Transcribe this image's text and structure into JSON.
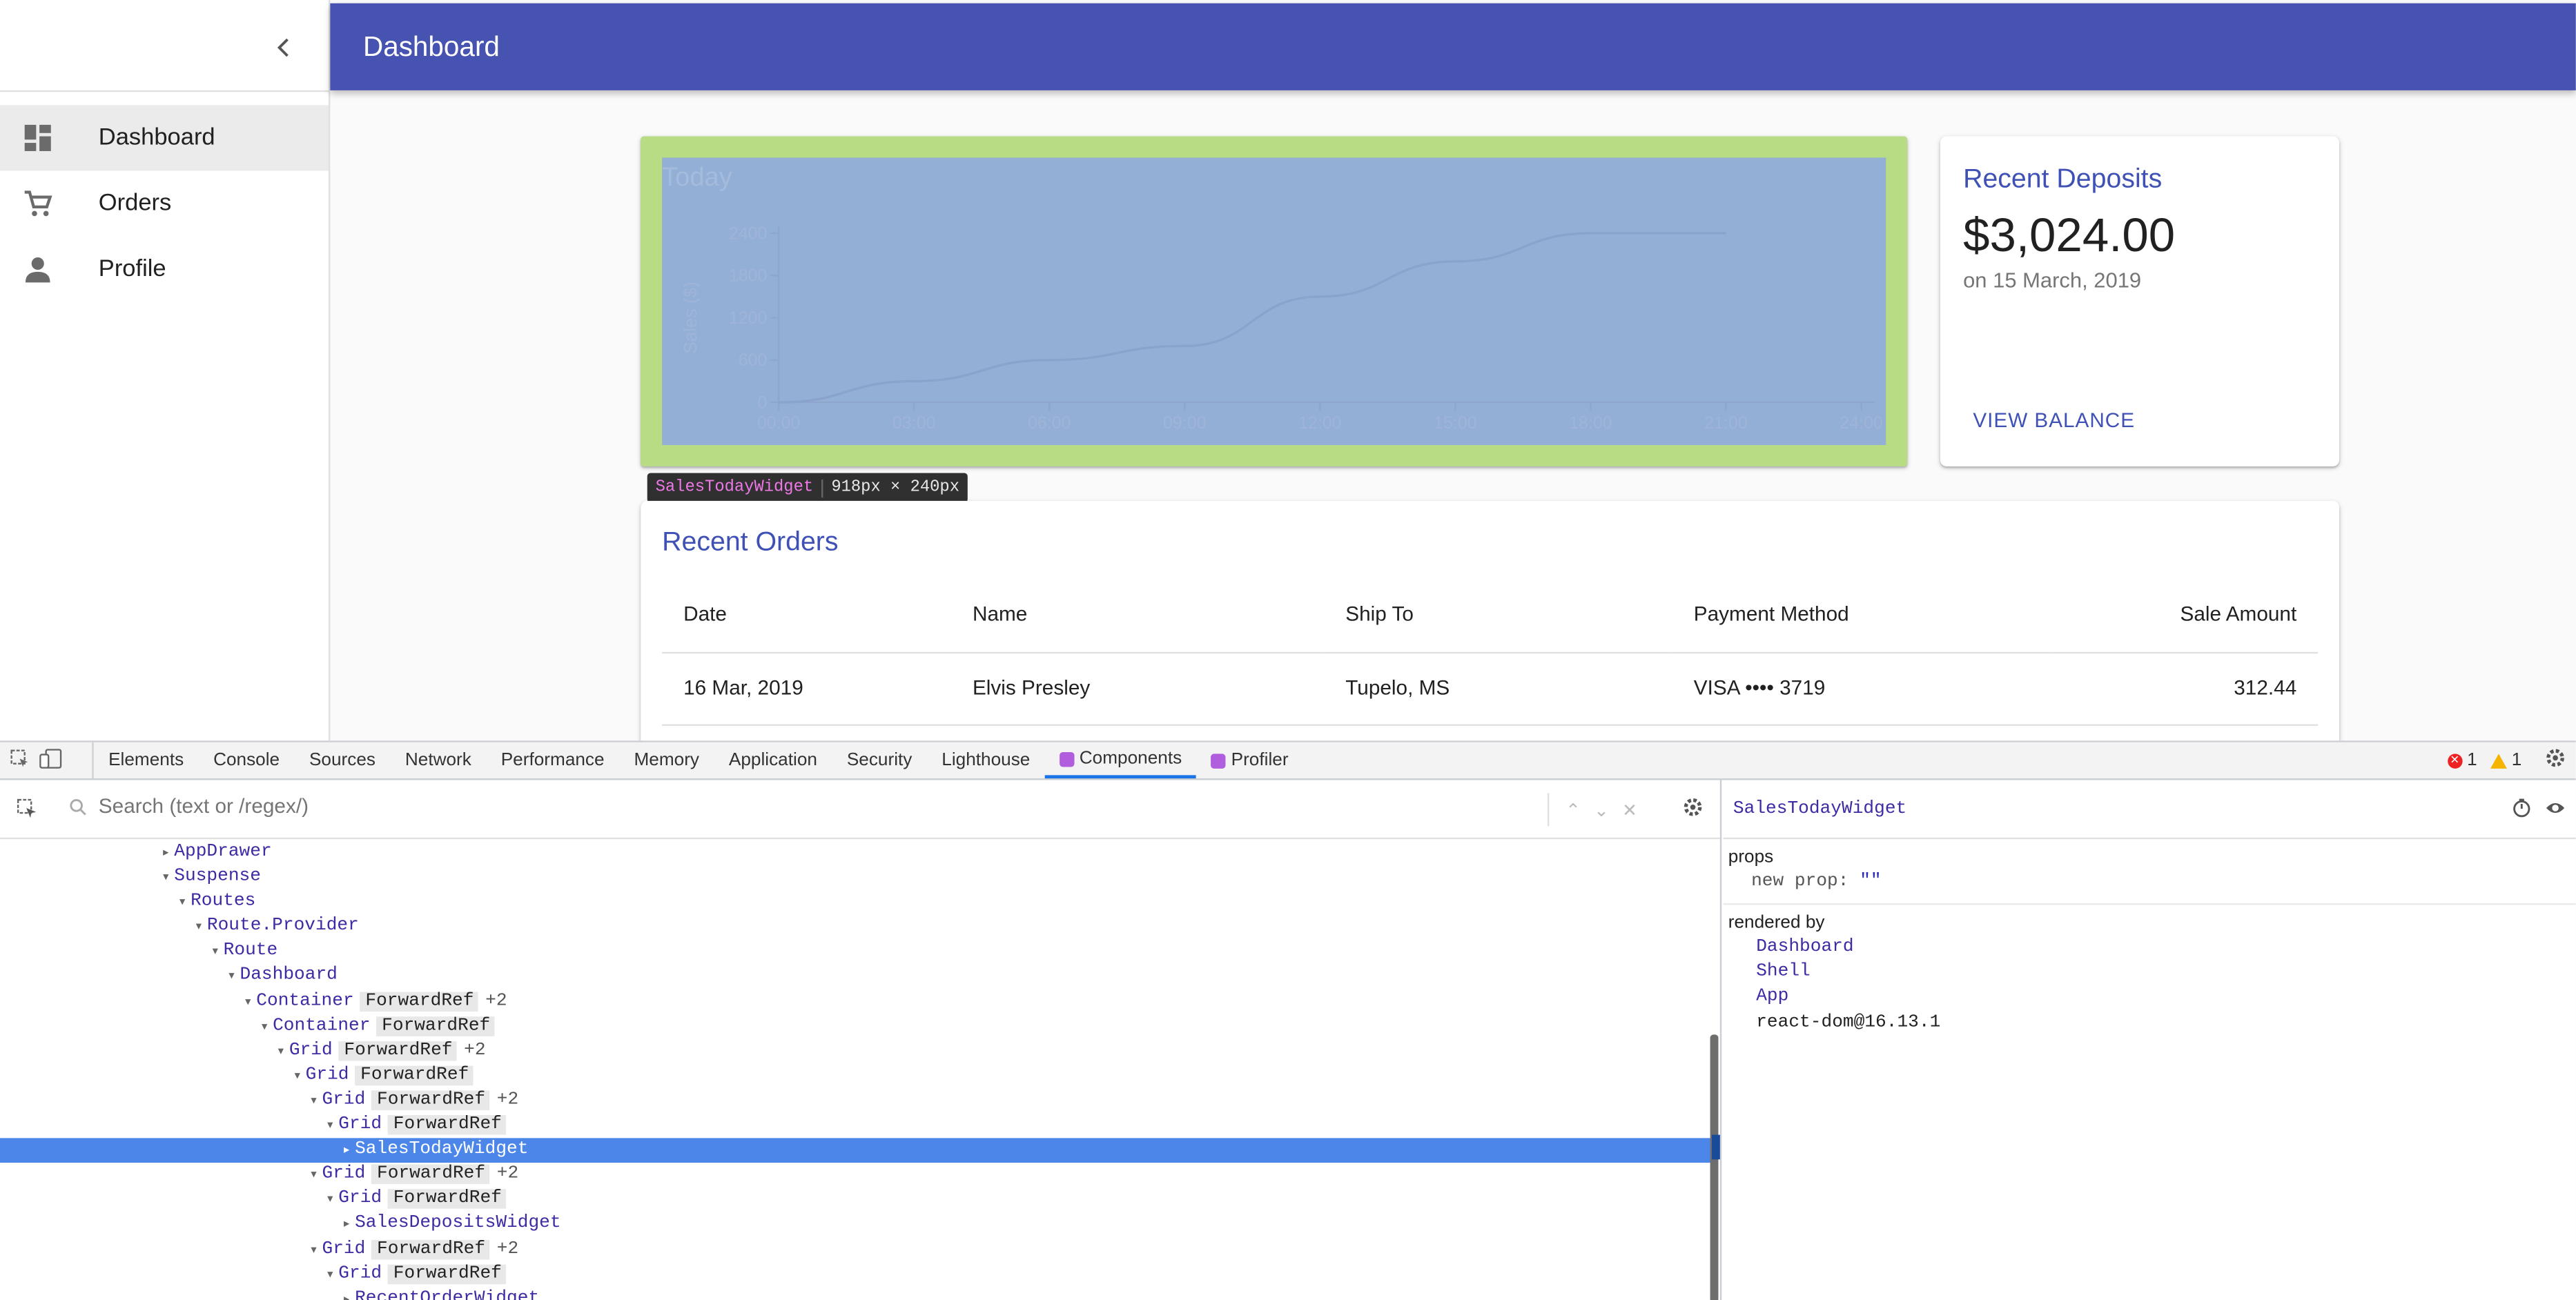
{
  "app": {
    "title": "Dashboard",
    "nav": [
      {
        "label": "Dashboard",
        "icon": "dashboard-icon",
        "active": true
      },
      {
        "label": "Orders",
        "icon": "cart-icon",
        "active": false
      },
      {
        "label": "Profile",
        "icon": "person-icon",
        "active": false
      }
    ],
    "today": {
      "title": "Today",
      "y_label": "Sales ($)",
      "x_ticks": [
        "00:00",
        "03:00",
        "06:00",
        "09:00",
        "12:00",
        "15:00",
        "18:00",
        "21:00",
        "24:00"
      ],
      "y_ticks": [
        "0",
        "600",
        "1200",
        "1800",
        "2400"
      ]
    },
    "inspect_tooltip": {
      "name": "SalesTodayWidget",
      "size": "918px × 240px"
    },
    "deposits": {
      "title": "Recent Deposits",
      "amount": "$3,024.00",
      "date": "on 15 March, 2019",
      "link": "VIEW BALANCE"
    },
    "orders": {
      "title": "Recent Orders",
      "columns": [
        "Date",
        "Name",
        "Ship To",
        "Payment Method",
        "Sale Amount"
      ],
      "rows": [
        {
          "date": "16 Mar, 2019",
          "name": "Elvis Presley",
          "ship_to": "Tupelo, MS",
          "payment": "VISA  •••• 3719",
          "amount": "312.44"
        }
      ]
    }
  },
  "chart_data": {
    "type": "line",
    "title": "Today",
    "ylabel": "Sales ($)",
    "xlabel": "",
    "x": [
      "00:00",
      "03:00",
      "06:00",
      "09:00",
      "12:00",
      "15:00",
      "18:00",
      "21:00"
    ],
    "values": [
      0,
      300,
      600,
      800,
      1500,
      2000,
      2400,
      2400
    ],
    "ylim": [
      0,
      2400
    ],
    "x_ticks": [
      "00:00",
      "03:00",
      "06:00",
      "09:00",
      "12:00",
      "15:00",
      "18:00",
      "21:00",
      "24:00"
    ],
    "y_ticks": [
      0,
      600,
      1200,
      1800,
      2400
    ],
    "grid": false
  },
  "devtools": {
    "tabs": [
      {
        "label": "Elements",
        "active": false,
        "react": false
      },
      {
        "label": "Console",
        "active": false,
        "react": false
      },
      {
        "label": "Sources",
        "active": false,
        "react": false
      },
      {
        "label": "Network",
        "active": false,
        "react": false
      },
      {
        "label": "Performance",
        "active": false,
        "react": false
      },
      {
        "label": "Memory",
        "active": false,
        "react": false
      },
      {
        "label": "Application",
        "active": false,
        "react": false
      },
      {
        "label": "Security",
        "active": false,
        "react": false
      },
      {
        "label": "Lighthouse",
        "active": false,
        "react": false
      },
      {
        "label": "Components",
        "active": true,
        "react": true
      },
      {
        "label": "Profiler",
        "active": false,
        "react": true
      }
    ],
    "errors": "1",
    "warnings": "1",
    "search_placeholder": "Search (text or /regex/)",
    "tree": [
      {
        "depth": 0,
        "arrow": "▸",
        "name": "AppDrawer",
        "hoc": "",
        "plus": ""
      },
      {
        "depth": 0,
        "arrow": "▾",
        "name": "Suspense",
        "hoc": "",
        "plus": ""
      },
      {
        "depth": 1,
        "arrow": "▾",
        "name": "Routes",
        "hoc": "",
        "plus": ""
      },
      {
        "depth": 2,
        "arrow": "▾",
        "name": "Route.Provider",
        "hoc": "",
        "plus": ""
      },
      {
        "depth": 3,
        "arrow": "▾",
        "name": "Route",
        "hoc": "",
        "plus": ""
      },
      {
        "depth": 4,
        "arrow": "▾",
        "name": "Dashboard",
        "hoc": "",
        "plus": ""
      },
      {
        "depth": 5,
        "arrow": "▾",
        "name": "Container",
        "hoc": "ForwardRef",
        "plus": "+2"
      },
      {
        "depth": 6,
        "arrow": "▾",
        "name": "Container",
        "hoc": "ForwardRef",
        "plus": ""
      },
      {
        "depth": 7,
        "arrow": "▾",
        "name": "Grid",
        "hoc": "ForwardRef",
        "plus": "+2"
      },
      {
        "depth": 8,
        "arrow": "▾",
        "name": "Grid",
        "hoc": "ForwardRef",
        "plus": ""
      },
      {
        "depth": 9,
        "arrow": "▾",
        "name": "Grid",
        "hoc": "ForwardRef",
        "plus": "+2"
      },
      {
        "depth": 10,
        "arrow": "▾",
        "name": "Grid",
        "hoc": "ForwardRef",
        "plus": ""
      },
      {
        "depth": 11,
        "arrow": "▸",
        "name": "SalesTodayWidget",
        "hoc": "",
        "plus": "",
        "selected": true
      },
      {
        "depth": 9,
        "arrow": "▾",
        "name": "Grid",
        "hoc": "ForwardRef",
        "plus": "+2"
      },
      {
        "depth": 10,
        "arrow": "▾",
        "name": "Grid",
        "hoc": "ForwardRef",
        "plus": ""
      },
      {
        "depth": 11,
        "arrow": "▸",
        "name": "SalesDepositsWidget",
        "hoc": "",
        "plus": ""
      },
      {
        "depth": 9,
        "arrow": "▾",
        "name": "Grid",
        "hoc": "ForwardRef",
        "plus": "+2"
      },
      {
        "depth": 10,
        "arrow": "▾",
        "name": "Grid",
        "hoc": "ForwardRef",
        "plus": ""
      },
      {
        "depth": 11,
        "arrow": "▸",
        "name": "RecentOrderWidget",
        "hoc": "",
        "plus": ""
      }
    ],
    "inspector": {
      "component": "SalesTodayWidget",
      "props_title": "props",
      "props": [
        {
          "key": "new prop",
          "value": "\"\""
        }
      ],
      "rendered_by_title": "rendered by",
      "rendered_by": [
        "Dashboard",
        "Shell",
        "App"
      ],
      "renderer": "react-dom@16.13.1"
    }
  },
  "colors": {
    "primary": "#3f51b5",
    "appbar": "#4753b0",
    "selection": "#4c86e8"
  }
}
